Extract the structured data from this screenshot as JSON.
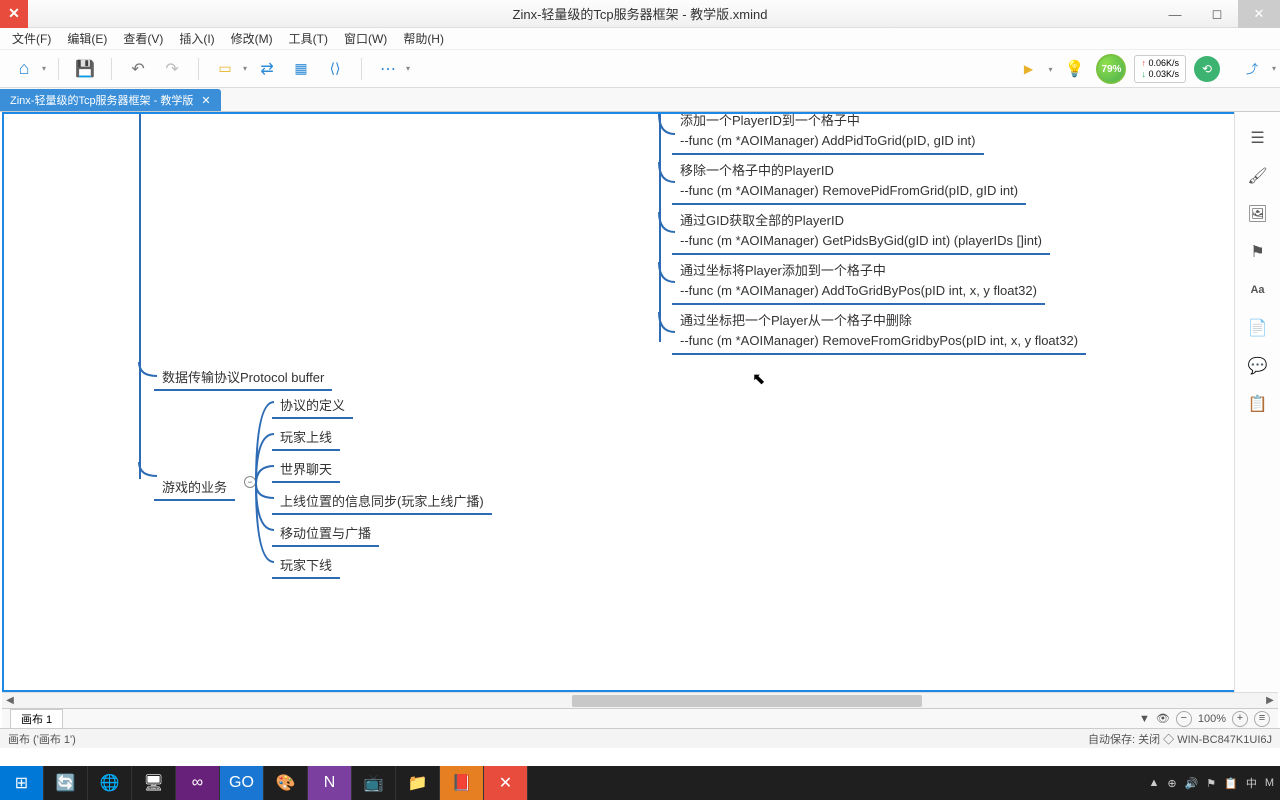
{
  "window": {
    "title": "Zinx-轻量级的Tcp服务器框架 - 教学版.xmind",
    "logo": "✕"
  },
  "menu": [
    "文件(F)",
    "编辑(E)",
    "查看(V)",
    "插入(I)",
    "修改(M)",
    "工具(T)",
    "窗口(W)",
    "帮助(H)"
  ],
  "toolbar_right": {
    "percent": "79%",
    "net_up": "0.06K/s",
    "net_dn": "0.03K/s"
  },
  "tab": {
    "label": "Zinx-轻量级的Tcp服务器框架 - 教学版",
    "close": "✕"
  },
  "mindmap": {
    "right_items": [
      {
        "t1": "添加一个PlayerID到一个格子中",
        "t2": "--func (m *AOIManager) AddPidToGrid(pID, gID int)"
      },
      {
        "t1": "移除一个格子中的PlayerID",
        "t2": "--func (m *AOIManager) RemovePidFromGrid(pID, gID int)"
      },
      {
        "t1": "通过GID获取全部的PlayerID",
        "t2": "--func (m *AOIManager) GetPidsByGid(gID int) (playerIDs []int)"
      },
      {
        "t1": "通过坐标将Player添加到一个格子中",
        "t2": "--func (m *AOIManager) AddToGridByPos(pID int, x, y float32)"
      },
      {
        "t1": "通过坐标把一个Player从一个格子中删除",
        "t2": "--func (m *AOIManager) RemoveFromGridbyPos(pID int, x, y float32)"
      }
    ],
    "left_branch1": "数据传输协议Protocol buffer",
    "left_branch2": "游戏的业务",
    "subs": [
      "协议的定义",
      "玩家上线",
      "世界聊天",
      "上线位置的信息同步(玩家上线广播)",
      "移动位置与广播",
      "玩家下线"
    ]
  },
  "sheet": {
    "name": "画布 1",
    "zoom": "100%"
  },
  "status": {
    "left": "画布 ('画布 1')",
    "right": "自动保存: 关闭 ◇ WIN-BC847K1UI6J"
  },
  "tray": {
    "items": [
      "▲",
      "⊕",
      "🔊",
      "⚑",
      "📋",
      "中",
      "M"
    ]
  }
}
